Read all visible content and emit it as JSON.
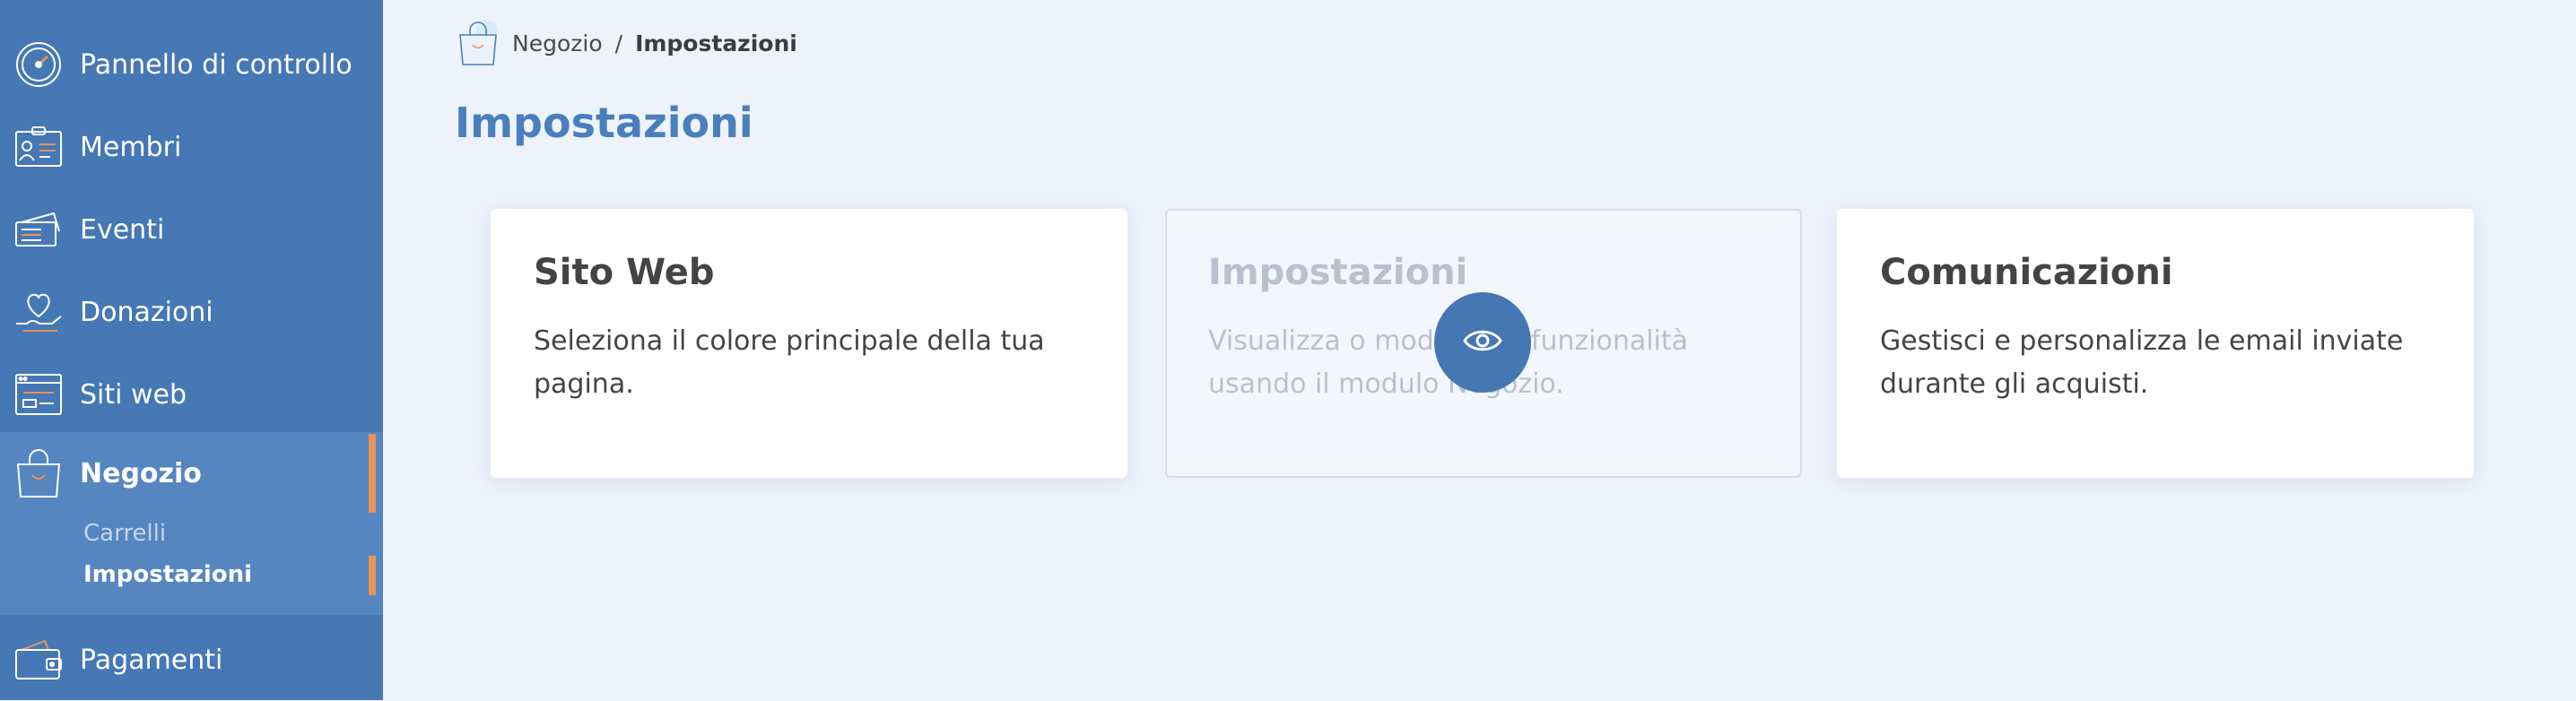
{
  "sidebar": {
    "items": [
      {
        "label": "Pannello di controllo",
        "icon": "speedometer-icon"
      },
      {
        "label": "Membri",
        "icon": "id-badge-icon"
      },
      {
        "label": "Eventi",
        "icon": "tickets-icon"
      },
      {
        "label": "Donazioni",
        "icon": "heart-hand-icon"
      },
      {
        "label": "Siti web",
        "icon": "browser-window-icon"
      },
      {
        "label": "Negozio",
        "icon": "shopping-bag-icon"
      },
      {
        "label": "Pagamenti",
        "icon": "wallet-icon"
      }
    ],
    "sub_items": [
      {
        "label": "Carrelli"
      },
      {
        "label": "Impostazioni"
      }
    ]
  },
  "breadcrumb": {
    "icon": "shopping-bag-icon",
    "parent": "Negozio",
    "separator": "/",
    "current": "Impostazioni"
  },
  "page": {
    "title": "Impostazioni"
  },
  "cards": [
    {
      "title": "Sito Web",
      "description": "Seleziona il colore principale della tua pagina."
    },
    {
      "title": "Impostazioni",
      "description": "Visualizza o modifica le funzionalità usando il modulo Negozio."
    },
    {
      "title": "Comunicazioni",
      "description": "Gestisci e personalizza le email inviate durante gli acquisti."
    }
  ],
  "overlay": {
    "icon": "eye-icon"
  },
  "colors": {
    "sidebar_bg": "#4578b4",
    "sidebar_active_bg": "#5686c0",
    "accent": "#e8935a",
    "title": "#4a7fbd",
    "page_bg": "#eef2fb"
  }
}
